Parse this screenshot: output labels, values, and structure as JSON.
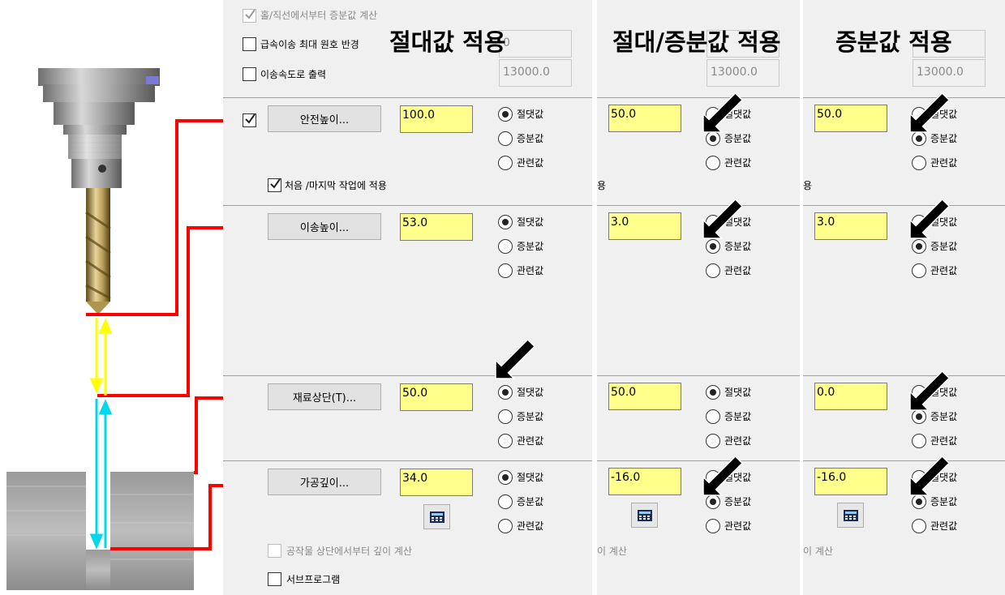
{
  "headings": [
    "절대값 적용",
    "절대/증분값 적용",
    "증분값 적용"
  ],
  "top_options": {
    "hole_calc": "홀/직선에서부터 증분값 계산",
    "rapid_arc": "급속이송 최대 원호 반경",
    "feed_output": "이송속도로 출력",
    "hidden_value_1": "0",
    "hidden_value_2": "13000.0"
  },
  "buttons": {
    "clearance": "안전높이...",
    "retract": "이송높이...",
    "top_stock": "재료상단(T)...",
    "depth": "가공깊이..."
  },
  "first_last": "처음 /마지막 작업에 적용",
  "depth_from_stock": "공작물 상단에서부터 깊이 계산",
  "subprogram": "서브프로그램",
  "radio_labels": {
    "absolute": "절댓값",
    "incremental": "증분값",
    "associative": "관련값"
  },
  "fragments": {
    "first_last_tail": "용",
    "depth_tail": "이 계산"
  },
  "columns": [
    {
      "name": "absolute",
      "values": [
        "100.0",
        "53.0",
        "50.0",
        "34.0"
      ],
      "selected": [
        "absolute",
        "absolute",
        "absolute",
        "absolute"
      ]
    },
    {
      "name": "absolute-incremental",
      "values": [
        "50.0",
        "3.0",
        "50.0",
        "-16.0"
      ],
      "selected": [
        "incremental",
        "incremental",
        "absolute",
        "incremental"
      ]
    },
    {
      "name": "incremental",
      "values": [
        "50.0",
        "3.0",
        "0.0",
        "-16.0"
      ],
      "selected": [
        "incremental",
        "incremental",
        "incremental",
        "incremental"
      ]
    }
  ],
  "colors": {
    "input_bg": "#ffff8c",
    "panel_bg": "#f0f0f0",
    "red_line": "#ff0000",
    "yellow_arrow": "#ffff00",
    "cyan_arrow": "#00d8f0"
  }
}
